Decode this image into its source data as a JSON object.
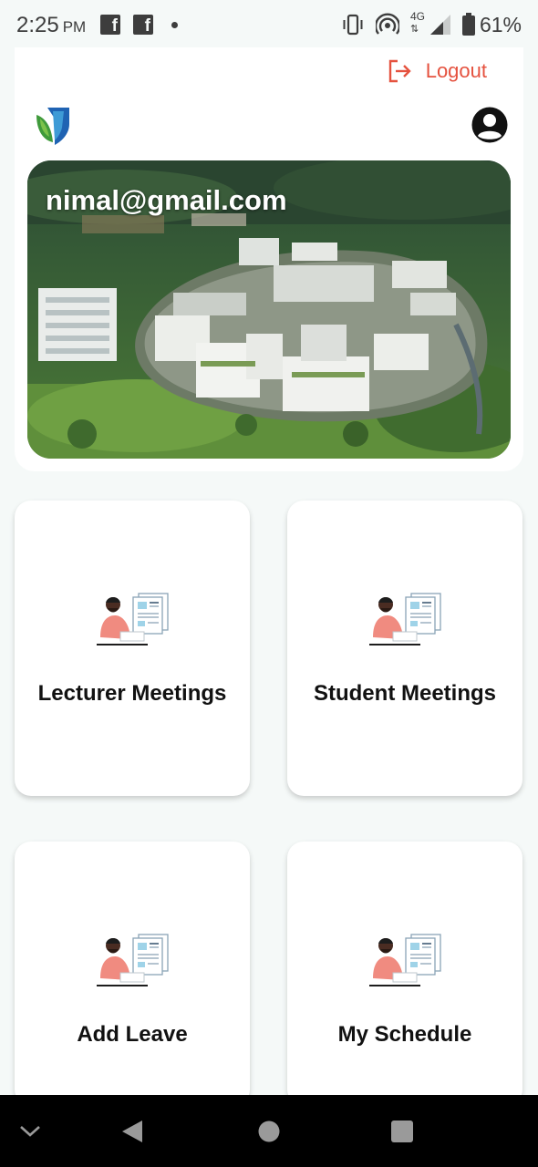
{
  "status_bar": {
    "time": "2:25",
    "ampm": "PM",
    "network": "4G",
    "battery": "61%",
    "icons": [
      "facebook-icon",
      "facebook-icon",
      "notification-dot",
      "vibrate-icon",
      "hotspot-icon",
      "signal-icon",
      "battery-icon"
    ]
  },
  "header": {
    "logout_label": "Logout",
    "logout_color": "#e5523f",
    "logo_icon": "university-shield-logo",
    "profile_icon": "account-circle-icon"
  },
  "banner": {
    "email": "nimal@gmail.com",
    "image": "aerial-campus-photo"
  },
  "tiles": [
    {
      "label": "Lecturer Meetings",
      "icon": "person-with-documents-illustration"
    },
    {
      "label": "Student Meetings",
      "icon": "person-with-documents-illustration"
    },
    {
      "label": "Add Leave",
      "icon": "person-with-documents-illustration"
    },
    {
      "label": "My Schedule",
      "icon": "person-with-documents-illustration"
    }
  ],
  "nav_bar": {
    "buttons": [
      "chevron-down-icon",
      "back-icon",
      "home-icon",
      "recents-icon"
    ]
  }
}
